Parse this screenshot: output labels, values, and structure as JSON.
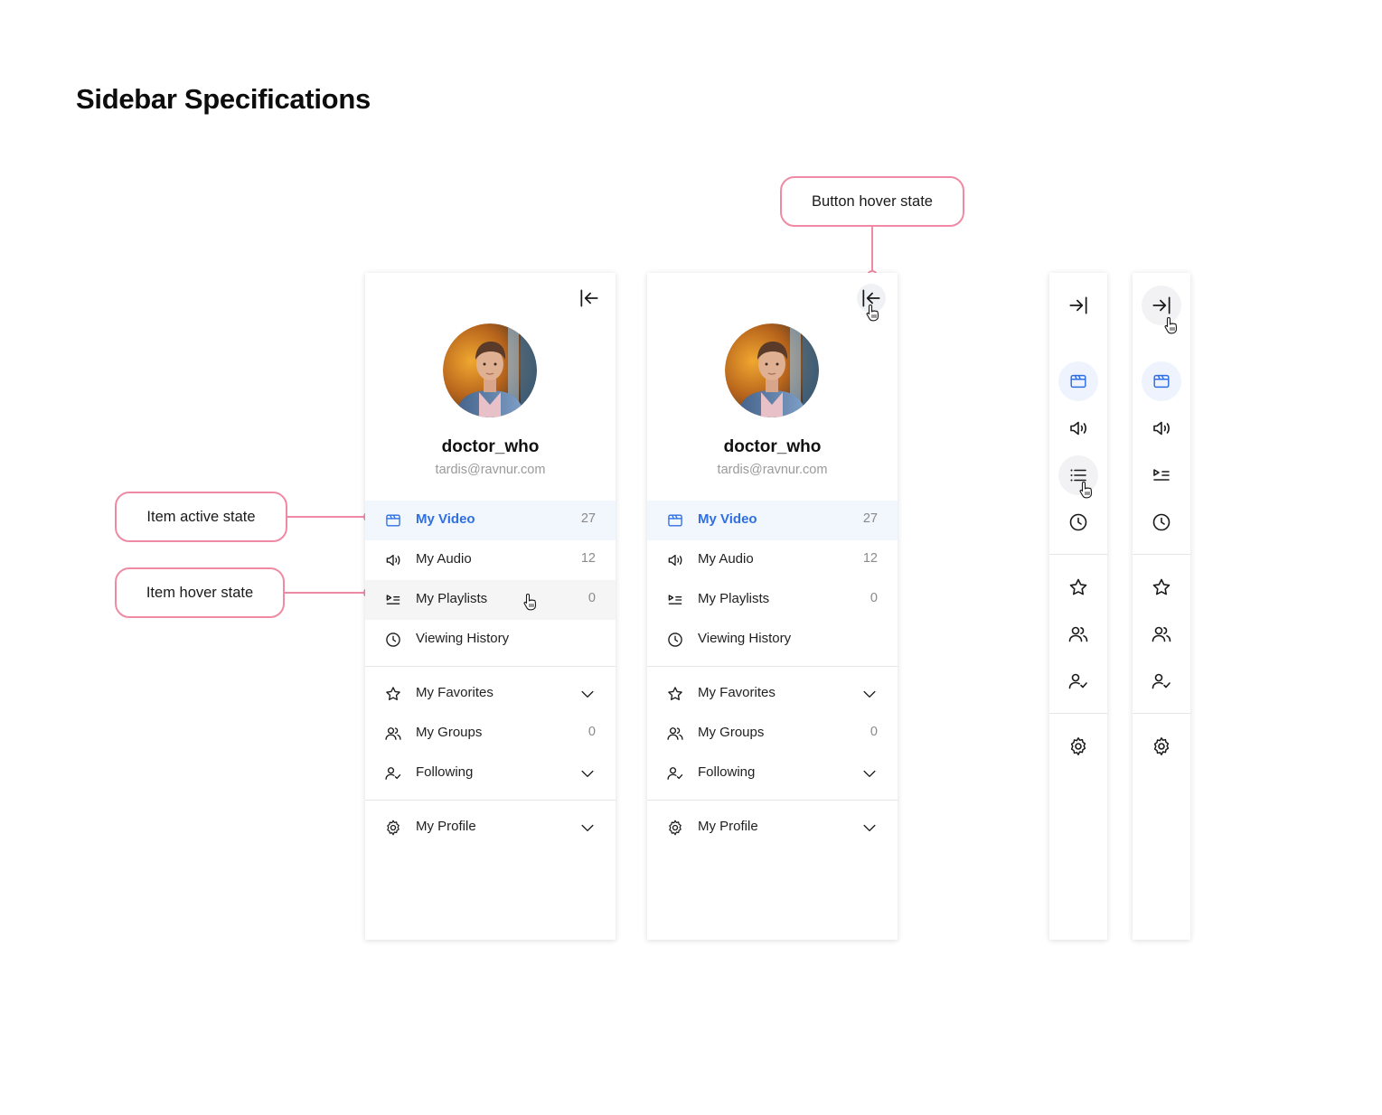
{
  "page": {
    "title": "Sidebar Specifications"
  },
  "callouts": {
    "button_hover": "Button hover state",
    "item_active": "Item active state",
    "item_hover": "Item hover state"
  },
  "colors": {
    "accent": "#2f6fe4",
    "callout": "#f08aa4",
    "active_bg": "#f2f6fd",
    "hover_bg": "#f5f5f6"
  },
  "profile": {
    "username": "doctor_who",
    "email": "tardis@ravnur.com"
  },
  "nav": {
    "my_video": {
      "label": "My Video",
      "count": "27",
      "icon": "video-calendar-icon"
    },
    "my_audio": {
      "label": "My Audio",
      "count": "12",
      "icon": "speaker-icon"
    },
    "my_playlists": {
      "label": "My Playlists",
      "count": "0",
      "icon": "playlist-icon"
    },
    "viewing_history": {
      "label": "Viewing History",
      "icon": "clock-icon"
    },
    "my_favorites": {
      "label": "My Favorites",
      "icon": "star-icon"
    },
    "my_groups": {
      "label": "My Groups",
      "count": "0",
      "icon": "users-icon"
    },
    "following": {
      "label": "Following",
      "icon": "user-check-icon"
    },
    "my_profile": {
      "label": "My Profile",
      "icon": "gear-icon"
    }
  }
}
